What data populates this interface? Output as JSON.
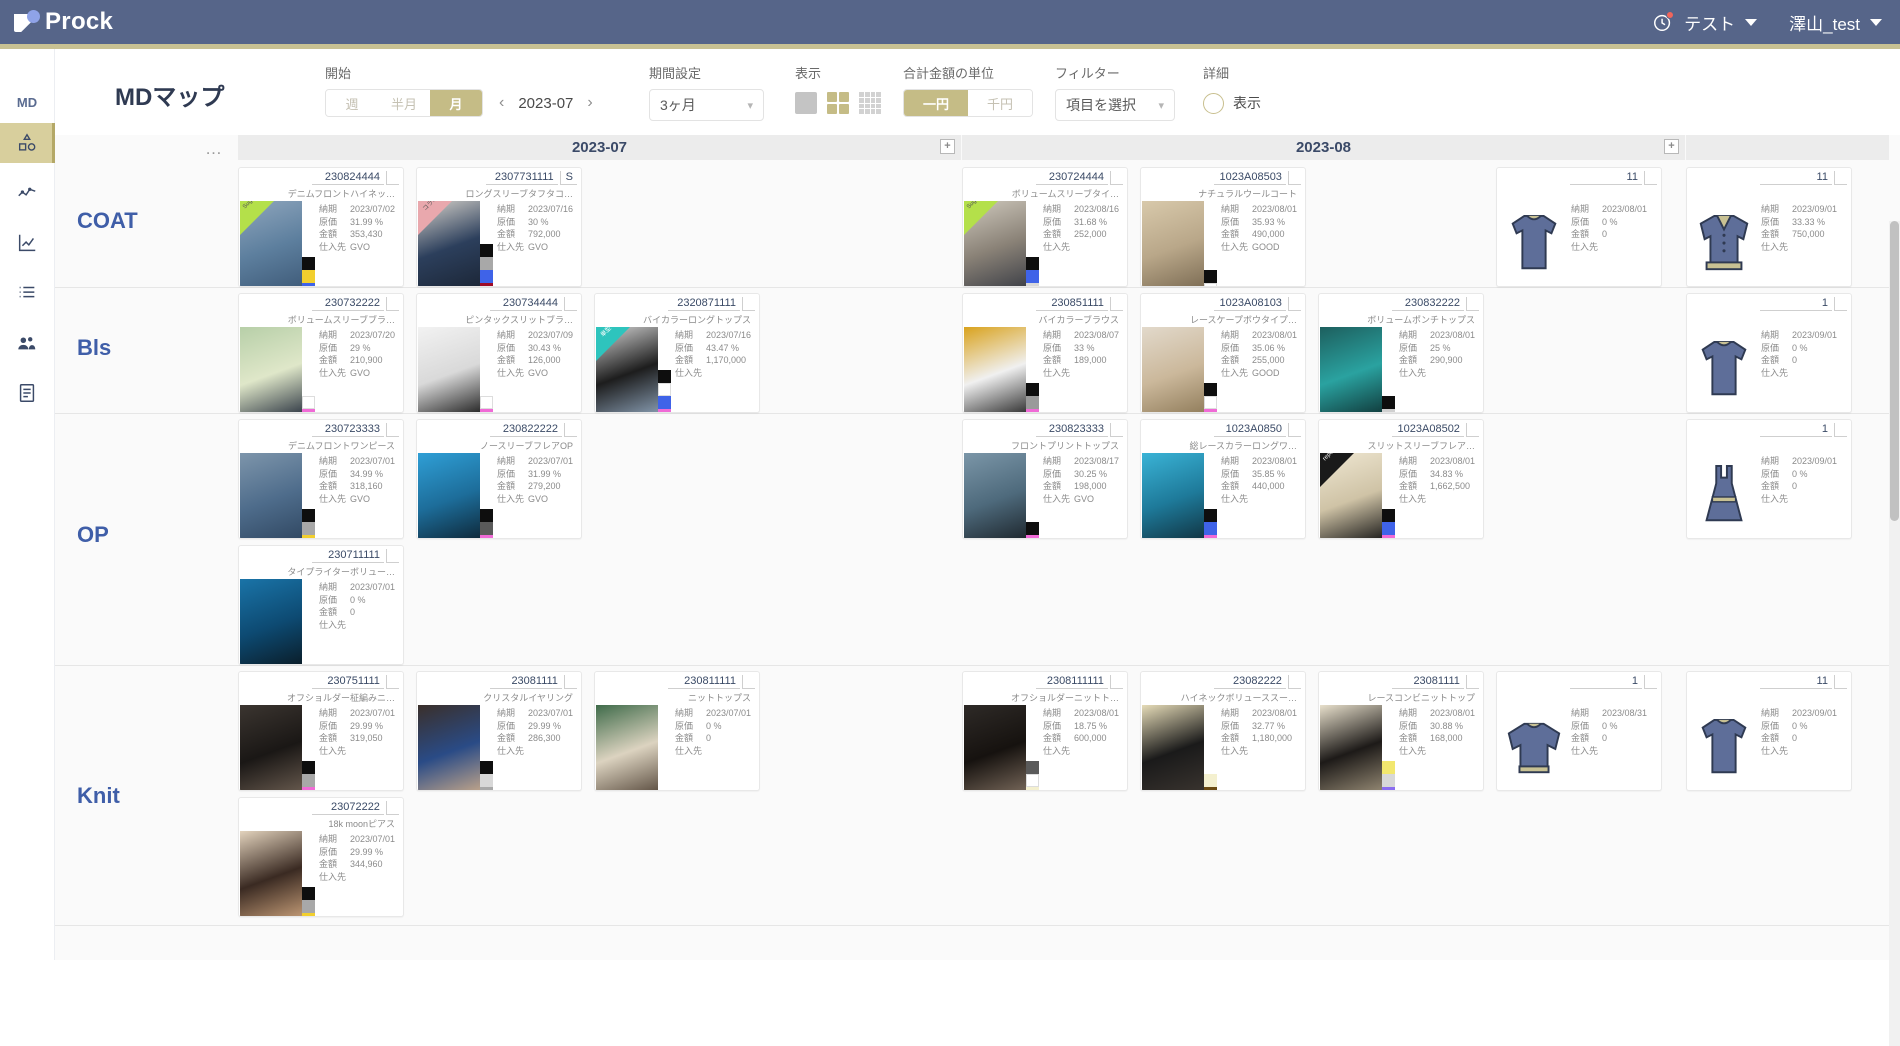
{
  "app": {
    "brand": "Prock",
    "page_title": "MDマップ",
    "accent_color": "#c8c193",
    "header_bg": "#566589"
  },
  "header": {
    "notification_label": "テスト",
    "user_name": "澤山_test"
  },
  "rail": {
    "items": [
      {
        "name": "md-label",
        "label": "MD",
        "icon": "md-text",
        "active": false
      },
      {
        "name": "md-map",
        "label": "",
        "icon": "shapes-icon",
        "active": true
      },
      {
        "name": "scatter",
        "label": "",
        "icon": "scatter-icon",
        "active": false
      },
      {
        "name": "trend",
        "label": "",
        "icon": "line-chart-icon",
        "active": false
      },
      {
        "name": "list",
        "label": "",
        "icon": "list-icon",
        "active": false
      },
      {
        "name": "members",
        "label": "",
        "icon": "people-icon",
        "active": false
      },
      {
        "name": "document",
        "label": "",
        "icon": "document-icon",
        "active": false
      }
    ]
  },
  "toolbar": {
    "start": {
      "label": "開始",
      "segments": [
        "週",
        "半月",
        "月"
      ],
      "selected": "月",
      "month_value": "2023-07",
      "prev_icon": "chevron-left-icon",
      "next_icon": "chevron-right-icon"
    },
    "period": {
      "label": "期間設定",
      "value": "3ヶ月"
    },
    "display": {
      "label": "表示",
      "icons": [
        "single-view-icon",
        "grid-view-icon",
        "dense-view-icon"
      ],
      "selected": "grid-view-icon"
    },
    "amount_unit": {
      "label": "合計金額の単位",
      "options": [
        "一円",
        "千円"
      ],
      "selected": "一円"
    },
    "filter": {
      "label": "フィルター",
      "value": "項目を選択"
    },
    "detail": {
      "label": "詳細",
      "toggle_label": "表示",
      "on": false
    }
  },
  "grid": {
    "dots": "…",
    "months": [
      {
        "label": "2023-07",
        "add_icon": "plus-icon"
      },
      {
        "label": "2023-08",
        "add_icon": "plus-icon"
      }
    ],
    "field_labels": {
      "due": "納期",
      "cost": "原価",
      "amount": "金額",
      "supplier": "仕入先"
    },
    "rows": [
      {
        "name": "COAT",
        "cards": [
          {
            "code": "230824444",
            "badge": "",
            "title": "デニムフロントハイネッ…",
            "due": "2023/07/02",
            "cost": "31.99 %",
            "amount": "353,430",
            "supplier": "GVO",
            "corner": {
              "color": "#b4e04a",
              "text": "Suga…"
            },
            "swatches": [
              "#0e0e0e",
              "#f2cf2e",
              "#3f63e8"
            ],
            "thumb": "denim-dress",
            "col": 0,
            "slot": 0
          },
          {
            "code": "2307731111",
            "badge": "S",
            "title": "ロングスリーブタフタコ…",
            "due": "2023/07/16",
            "cost": "30 %",
            "amount": "792,000",
            "supplier": "GVO",
            "corner": {
              "color": "#e9a8ad",
              "text": "コラボ"
            },
            "swatches": [
              "#0e0e0e",
              "#a8a8a8",
              "#3f63e8",
              "#9e0b26"
            ],
            "thumb": "tafta-coat",
            "col": 0,
            "slot": 1
          },
          {
            "code": "230724444",
            "badge": "",
            "title": "ボリュームスリーブタイ…",
            "due": "2023/08/16",
            "cost": "31.68 %",
            "amount": "252,000",
            "supplier": "",
            "corner": {
              "color": "#b4e04a",
              "text": "Suga…"
            },
            "swatches": [
              "#0e0e0e",
              "#3f63e8",
              "#d8d8d8"
            ],
            "thumb": "beige-coat",
            "col": 1,
            "slot": 0
          },
          {
            "code": "1023A08503",
            "badge": "",
            "title": "ナチュラルウールコート",
            "due": "2023/08/01",
            "cost": "35.93 %",
            "amount": "490,000",
            "supplier": "GOOD",
            "corner": null,
            "swatches": [
              "#0e0e0e",
              "#ffffff"
            ],
            "thumb": "wool-coat",
            "col": 1,
            "slot": 1
          },
          {
            "code": "11",
            "badge": "",
            "title": "",
            "due": "2023/08/01",
            "cost": "0 %",
            "amount": "0",
            "supplier": "",
            "corner": null,
            "swatches": [],
            "thumb": "tshirt-icon",
            "placeholder": true,
            "col": 1,
            "slot": 3
          },
          {
            "code": "11",
            "badge": "",
            "title": "",
            "due": "2023/09/01",
            "cost": "33.33 %",
            "amount": "750,000",
            "supplier": "",
            "corner": null,
            "swatches": [],
            "thumb": "jacket-icon",
            "placeholder": true,
            "col": 2,
            "slot": 0
          }
        ]
      },
      {
        "name": "Bls",
        "cards": [
          {
            "code": "230732222",
            "badge": "",
            "title": "ボリュームスリーブブラ…",
            "due": "2023/07/20",
            "cost": "29 %",
            "amount": "210,900",
            "supplier": "GVO",
            "corner": null,
            "swatches": [
              "#ffffff",
              "#f06ad6"
            ],
            "thumb": "green-blouse",
            "col": 0,
            "slot": 0
          },
          {
            "code": "230734444",
            "badge": "",
            "title": "ピンタックスリットブラ…",
            "due": "2023/07/09",
            "cost": "30.43 %",
            "amount": "126,000",
            "supplier": "GVO",
            "corner": null,
            "swatches": [
              "#ffffff",
              "#f06ad6"
            ],
            "thumb": "white-blouse",
            "col": 0,
            "slot": 1
          },
          {
            "code": "2320871111",
            "badge": "",
            "title": "バイカラーロングトップス",
            "due": "2023/07/16",
            "cost": "43.47 %",
            "amount": "1,170,000",
            "supplier": "",
            "corner": {
              "color": "#2ec4bd",
              "text": "単型"
            },
            "swatches": [
              "#0e0e0e",
              "#ffffff",
              "#3f63e8",
              "#f06ad6"
            ],
            "thumb": "bicolor-top",
            "col": 0,
            "slot": 2
          },
          {
            "code": "230851111",
            "badge": "",
            "title": "バイカラーブラウス",
            "due": "2023/08/07",
            "cost": "33 %",
            "amount": "189,000",
            "supplier": "",
            "corner": null,
            "swatches": [
              "#0e0e0e",
              "#9a9a9a",
              "#f06ad6"
            ],
            "thumb": "mustard-blouse",
            "col": 1,
            "slot": 0
          },
          {
            "code": "1023A08103",
            "badge": "",
            "title": "レースケープボウタイプ…",
            "due": "2023/08/01",
            "cost": "35.06 %",
            "amount": "255,000",
            "supplier": "GOOD",
            "corner": null,
            "swatches": [
              "#0e0e0e",
              "#ffffff",
              "#f06ad6"
            ],
            "thumb": "lace-cape",
            "col": 1,
            "slot": 1
          },
          {
            "code": "230832222",
            "badge": "",
            "title": "ボリュームポンチトップス",
            "due": "2023/08/01",
            "cost": "25 %",
            "amount": "290,900",
            "supplier": "",
            "corner": null,
            "swatches": [
              "#0e0e0e",
              "#d0d0d0"
            ],
            "thumb": "teal-top",
            "col": 1,
            "slot": 2
          },
          {
            "code": "1",
            "badge": "",
            "title": "",
            "due": "2023/09/01",
            "cost": "0 %",
            "amount": "0",
            "supplier": "",
            "corner": null,
            "swatches": [],
            "thumb": "tshirt-icon",
            "placeholder": true,
            "col": 2,
            "slot": 0
          }
        ]
      },
      {
        "name": "OP",
        "cards": [
          {
            "code": "230723333",
            "badge": "",
            "title": "デニムフロントワンピース",
            "due": "2023/07/01",
            "cost": "34.99 %",
            "amount": "318,160",
            "supplier": "GVO",
            "corner": null,
            "swatches": [
              "#0e0e0e",
              "#a8a8a8",
              "#f2cf2e"
            ],
            "thumb": "denim-onepiece",
            "col": 0,
            "slot": 0
          },
          {
            "code": "230822222",
            "badge": "",
            "title": "ノースリーブフレアOP",
            "due": "2023/07/01",
            "cost": "31.99 %",
            "amount": "279,200",
            "supplier": "GVO",
            "corner": null,
            "swatches": [
              "#0e0e0e",
              "#5a5a5a",
              "#f06ad6"
            ],
            "thumb": "blue-dress",
            "col": 0,
            "slot": 1
          },
          {
            "code": "230823333",
            "badge": "",
            "title": "フロントプリントトップス",
            "due": "2023/08/17",
            "cost": "30.25 %",
            "amount": "198,000",
            "supplier": "GVO",
            "corner": null,
            "swatches": [
              "#0e0e0e",
              "#f06ad6"
            ],
            "thumb": "print-top",
            "col": 1,
            "slot": 0
          },
          {
            "code": "1023A0850",
            "badge": "",
            "title": "総レースカラーロングワ…",
            "due": "2023/08/01",
            "cost": "35.85 %",
            "amount": "440,000",
            "supplier": "",
            "corner": null,
            "swatches": [
              "#0e0e0e",
              "#3f63e8",
              "#f06ad6"
            ],
            "thumb": "lace-long",
            "col": 1,
            "slot": 1
          },
          {
            "code": "1023A08502",
            "badge": "",
            "title": "スリットスリーブフレア…",
            "due": "2023/08/01",
            "cost": "34.83 %",
            "amount": "1,662,500",
            "supplier": "",
            "corner": {
              "color": "#1a1a1a",
              "text": "repeat"
            },
            "swatches": [
              "#0e0e0e",
              "#3f63e8",
              "#f06ad6"
            ],
            "thumb": "ivory-dress",
            "col": 1,
            "slot": 2
          },
          {
            "code": "1",
            "badge": "",
            "title": "",
            "due": "2023/09/01",
            "cost": "0 %",
            "amount": "0",
            "supplier": "",
            "corner": null,
            "swatches": [],
            "thumb": "dress-icon",
            "placeholder": true,
            "col": 2,
            "slot": 0
          },
          {
            "code": "230711111",
            "badge": "",
            "title": "タイプライターボリュー…",
            "due": "2023/07/01",
            "cost": "0 %",
            "amount": "0",
            "supplier": "",
            "corner": null,
            "swatches": [],
            "thumb": "blue-cape",
            "col": 0,
            "slot": 0,
            "row2": true
          }
        ]
      },
      {
        "name": "Knit",
        "cards": [
          {
            "code": "230751111",
            "badge": "",
            "title": "オフショルダー柾編みニ…",
            "due": "2023/07/01",
            "cost": "29.99 %",
            "amount": "319,050",
            "supplier": "",
            "corner": null,
            "swatches": [
              "#0e0e0e",
              "#a8a8a8",
              "#f06ad6"
            ],
            "thumb": "black-knit",
            "col": 0,
            "slot": 0
          },
          {
            "code": "23081111",
            "badge": "",
            "title": "クリスタルイヤリング",
            "due": "2023/07/01",
            "cost": "29.99 %",
            "amount": "286,300",
            "supplier": "",
            "corner": null,
            "swatches": [
              "#0e0e0e",
              "#d8d8d8",
              "#a8a8a8"
            ],
            "thumb": "earring",
            "col": 0,
            "slot": 1
          },
          {
            "code": "230811111",
            "badge": "",
            "title": "ニットトップス",
            "due": "2023/07/01",
            "cost": "0 %",
            "amount": "0",
            "supplier": "",
            "corner": null,
            "swatches": [],
            "thumb": "green-knit",
            "col": 0,
            "slot": 2
          },
          {
            "code": "2308111111",
            "badge": "",
            "title": "オフショルダーニットト…",
            "due": "2023/08/01",
            "cost": "18.75 %",
            "amount": "600,000",
            "supplier": "",
            "corner": null,
            "swatches": [
              "#5a5a5a",
              "#ffffff",
              "#f4f0cf"
            ],
            "thumb": "black-offshoulder",
            "col": 1,
            "slot": 0
          },
          {
            "code": "23082222",
            "badge": "",
            "title": "ハイネックボリューススー…",
            "due": "2023/08/01",
            "cost": "32.77 %",
            "amount": "1,180,000",
            "supplier": "",
            "corner": null,
            "swatches": [
              "#f4f0cf",
              "#6b4a12"
            ],
            "thumb": "cream-knit",
            "col": 1,
            "slot": 1
          },
          {
            "code": "23081111",
            "badge": "",
            "title": "レースコンビニットトップ",
            "due": "2023/08/01",
            "cost": "30.88 %",
            "amount": "168,000",
            "supplier": "",
            "corner": null,
            "swatches": [
              "#f2e76e",
              "#d8d8d8",
              "#8b6df0"
            ],
            "thumb": "lace-knit",
            "col": 1,
            "slot": 2
          },
          {
            "code": "1",
            "badge": "",
            "title": "",
            "due": "2023/08/31",
            "cost": "0 %",
            "amount": "0",
            "supplier": "",
            "corner": null,
            "swatches": [],
            "thumb": "sweater-icon",
            "placeholder": true,
            "col": 1,
            "slot": 3
          },
          {
            "code": "11",
            "badge": "",
            "title": "",
            "due": "2023/09/01",
            "cost": "0 %",
            "amount": "0",
            "supplier": "",
            "corner": null,
            "swatches": [],
            "thumb": "tshirt-icon",
            "placeholder": true,
            "col": 2,
            "slot": 0
          },
          {
            "code": "23072222",
            "badge": "",
            "title": "18k moonピアス",
            "due": "2023/07/01",
            "cost": "29.99 %",
            "amount": "344,960",
            "supplier": "",
            "corner": null,
            "swatches": [
              "#0e0e0e",
              "#a8a8a8",
              "#f2cf2e"
            ],
            "thumb": "cream-top",
            "col": 0,
            "slot": 0,
            "row2": true
          }
        ]
      }
    ]
  }
}
